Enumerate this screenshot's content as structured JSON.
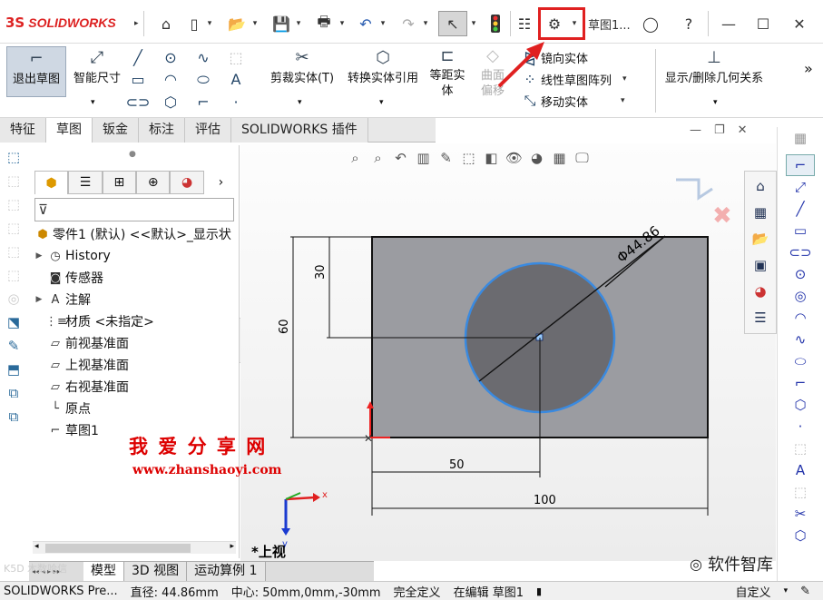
{
  "app": {
    "logo_prefix": "3S",
    "logo_text": "SOLIDWORKS",
    "doc_title": "草图1..."
  },
  "quick_access": {
    "icons": [
      "home-icon",
      "new-file-icon",
      "open-icon",
      "save-icon",
      "print-icon",
      "undo-icon",
      "redo-icon",
      "select-icon",
      "traffic-light-icon",
      "file-props-icon",
      "options-gear-icon",
      "user-icon",
      "help-icon"
    ]
  },
  "window_controls": {
    "minimize": "—",
    "maximize": "☐",
    "close": "✕"
  },
  "ribbon": {
    "exit_sketch": "退出草图",
    "smart_dimension": "智能尺寸",
    "trim": "剪裁实体(T)",
    "convert": "转换实体引用",
    "offset_l1": "等距实",
    "offset_l2": "体",
    "surface_offset_l1": "曲面",
    "surface_offset_l2": "偏移",
    "mirror": "镜向实体",
    "linear_pattern": "线性草图阵列",
    "move": "移动实体",
    "show_relations": "显示/删除几何关系",
    "more": "»"
  },
  "tabs": [
    "特征",
    "草图",
    "钣金",
    "标注",
    "评估",
    "SOLIDWORKS 插件"
  ],
  "active_tab": "草图",
  "tree": {
    "root": "零件1 (默认) <<默认>_显示状",
    "items": [
      {
        "label": "History",
        "icon": "history-icon",
        "expand": true
      },
      {
        "label": "传感器",
        "icon": "sensor-icon",
        "expand": false
      },
      {
        "label": "注解",
        "icon": "annotation-icon",
        "expand": true
      },
      {
        "label": "材质 <未指定>",
        "icon": "material-icon",
        "expand": false
      },
      {
        "label": "前视基准面",
        "icon": "plane-icon",
        "expand": false
      },
      {
        "label": "上视基准面",
        "icon": "plane-icon",
        "expand": false
      },
      {
        "label": "右视基准面",
        "icon": "plane-icon",
        "expand": false
      },
      {
        "label": "原点",
        "icon": "origin-icon",
        "expand": false
      },
      {
        "label": "草图1",
        "icon": "sketch-icon",
        "expand": false
      }
    ]
  },
  "watermark": {
    "title": "我 爱 分 享 网",
    "url": "www.zhanshaoyi.com",
    "wechat": "软件智库",
    "corner": "K5D 木数哈信"
  },
  "sketch": {
    "dim_diameter": "Φ44.86",
    "dim_30": "30",
    "dim_60": "60",
    "dim_50": "50",
    "dim_100": "100",
    "view_label": "*上视",
    "axis_x": "x",
    "axis_y": "y"
  },
  "bottom_tabs": [
    "模型",
    "3D 视图",
    "运动算例 1"
  ],
  "active_bottom_tab": "模型",
  "status": {
    "app": "SOLIDWORKS Pre...",
    "diameter": "直径: 44.86mm",
    "center": "中心: 50mm,0mm,-30mm",
    "state": "完全定义",
    "editing": "在编辑 草图1",
    "custom": "自定义"
  },
  "colors": {
    "highlight_red": "#e02020",
    "sketch_blue": "#2a7ad8",
    "plate": "#9d9da2",
    "circle": "#6b6b6f"
  }
}
